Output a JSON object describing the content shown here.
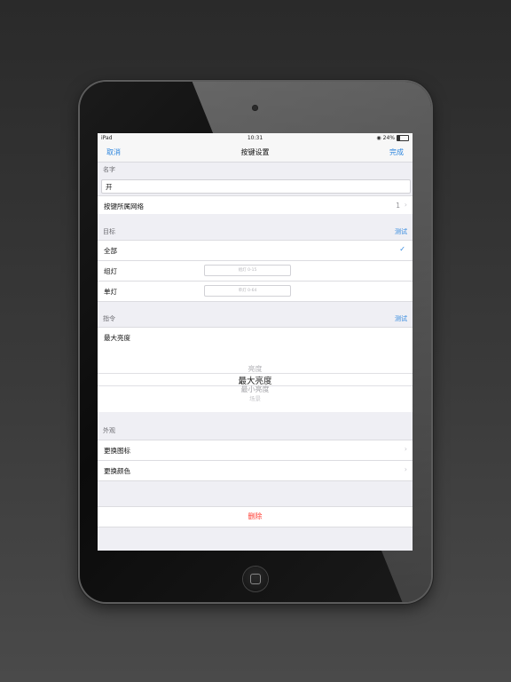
{
  "status_bar": {
    "device": "iPad",
    "time": "10:31",
    "battery": "24%"
  },
  "nav": {
    "cancel": "取消",
    "title": "按键设置",
    "done": "完成"
  },
  "name_section": {
    "header": "名字",
    "value": "开"
  },
  "network_row": {
    "label": "按键所属网络",
    "value": "1"
  },
  "target_section": {
    "header": "目标",
    "test": "测试",
    "all": "全部",
    "group_label": "组灯",
    "group_placeholder": "组灯 0-15",
    "single_label": "单灯",
    "single_placeholder": "单灯 0-64"
  },
  "command_section": {
    "header": "指令",
    "test": "测试",
    "selected": "最大亮度",
    "picker": [
      "亮度",
      "最大亮度",
      "最小亮度",
      "场景"
    ]
  },
  "appearance_section": {
    "header": "外观",
    "change_icon": "更换图标",
    "change_color": "更换颜色"
  },
  "delete_label": "删除",
  "colors": {
    "accent": "#2e86de",
    "destructive": "#ff3b30"
  }
}
